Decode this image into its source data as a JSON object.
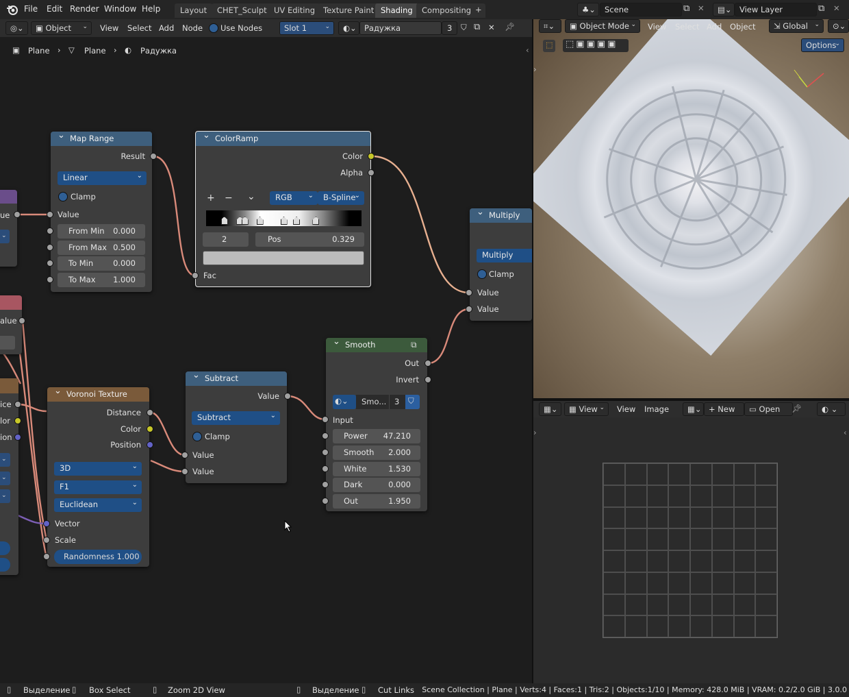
{
  "menu": {
    "file": "File",
    "edit": "Edit",
    "render": "Render",
    "window": "Window",
    "help": "Help"
  },
  "workspaces": [
    {
      "label": "Layout",
      "active": false
    },
    {
      "label": "CHET_Sculpt",
      "active": false
    },
    {
      "label": "UV Editing",
      "active": false
    },
    {
      "label": "Texture Paint",
      "active": false
    },
    {
      "label": "Shading",
      "active": true
    },
    {
      "label": "Compositing",
      "active": false
    }
  ],
  "add_workspace": "+",
  "scene": {
    "label": "Scene"
  },
  "view_layer": {
    "label": "View Layer"
  },
  "node_header": {
    "object_type": "Object",
    "view": "View",
    "select": "Select",
    "add": "Add",
    "node": "Node",
    "use_nodes": "Use Nodes",
    "slot": "Slot 1",
    "material": "Радужка",
    "users": "3"
  },
  "breadcrumb": {
    "item1": "Plane",
    "item2": "Plane",
    "item3": "Радужка"
  },
  "viewport_header": {
    "mode": "Object Mode",
    "view": "View",
    "select": "Select",
    "add": "Add",
    "object": "Object",
    "orientation": "Global",
    "options": "Options"
  },
  "image_header": {
    "view_dd": "View",
    "view": "View",
    "image": "Image",
    "new": "New",
    "open": "Open"
  },
  "nodes": {
    "map_range": {
      "title": "Map Range",
      "result": "Result",
      "interp": "Linear",
      "clamp": "Clamp",
      "value": "Value",
      "from_min_label": "From Min",
      "from_min": "0.000",
      "from_max_label": "From Max",
      "from_max": "0.500",
      "to_min_label": "To Min",
      "to_min": "0.000",
      "to_max_label": "To Max",
      "to_max": "1.000"
    },
    "colorramp": {
      "title": "ColorRamp",
      "color": "Color",
      "alpha": "Alpha",
      "plus": "+",
      "minus": "−",
      "menu": "⌄",
      "color_mode": "RGB",
      "interp": "B-Spline",
      "index": "2",
      "pos_label": "Pos",
      "pos": "0.329",
      "fac": "Fac",
      "stops": [
        0.117,
        0.218,
        0.25,
        0.346,
        0.5,
        0.582,
        0.707
      ]
    },
    "multiply": {
      "title": "Multiply",
      "op": "Multiply",
      "clamp": "Clamp",
      "value1": "Value",
      "value2": "Value"
    },
    "smooth": {
      "title": "Smooth",
      "out": "Out",
      "invert": "Invert",
      "group_name": "Smo...",
      "group_users": "3",
      "input": "Input",
      "power_label": "Power",
      "power": "47.210",
      "smooth_label": "Smooth",
      "smooth": "2.000",
      "white_label": "White",
      "white": "1.530",
      "dark_label": "Dark",
      "dark": "0.000",
      "out_label": "Out",
      "out_val": "1.950"
    },
    "subtract": {
      "title": "Subtract",
      "value_out": "Value",
      "op": "Subtract",
      "clamp": "Clamp",
      "value1": "Value",
      "value2": "Value"
    },
    "voronoi": {
      "title": "Voronoi Texture",
      "distance": "Distance",
      "color": "Color",
      "position": "Position",
      "dims": "3D",
      "feature": "F1",
      "metric": "Euclidean",
      "vector": "Vector",
      "scale": "Scale",
      "rand_label": "Randomness",
      "rand": "1.000"
    },
    "partial": {
      "p1_value": "ue",
      "p2_value": "alue",
      "p3_a": "ice",
      "p3_b": "lor",
      "p3_c": "ion"
    }
  },
  "statusbar": {
    "s1": "Выделение",
    "s2": "Box Select",
    "s3": "Zoom 2D View",
    "s4": "Выделение",
    "s5": "Cut Links",
    "stats": "Scene Collection | Plane | Verts:4 | Faces:1 | Tris:2 | Objects:1/10 | Memory: 428.0 MiB | VRAM: 0.2/2.0 GiB | 3.0.0"
  }
}
